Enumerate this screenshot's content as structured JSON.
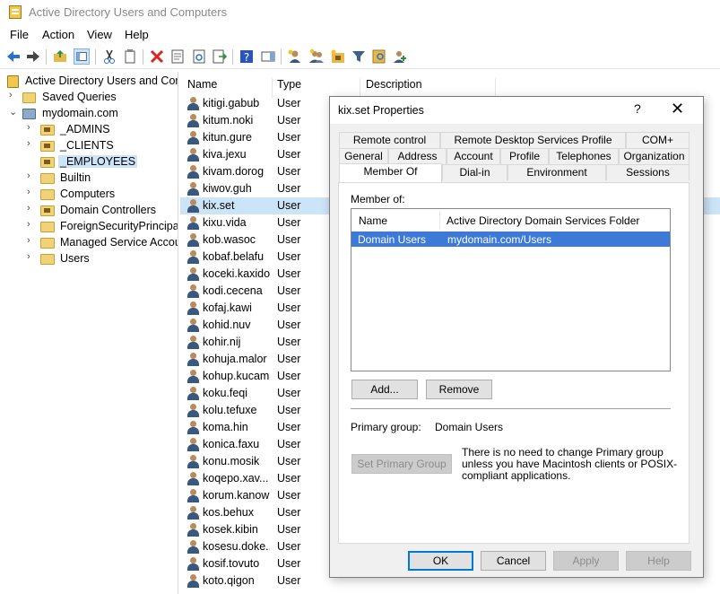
{
  "window": {
    "title": "Active Directory Users and Computers"
  },
  "menu": [
    "File",
    "Action",
    "View",
    "Help"
  ],
  "toolbar": {
    "icons": [
      "back-icon",
      "forward-icon",
      "up-folder-icon",
      "show-hide-console-tree-icon",
      "cut-icon",
      "copy-icon",
      "delete-icon",
      "properties-icon",
      "refresh-icon",
      "export-list-icon",
      "help-icon",
      "show-action-pane-icon",
      "new-user-icon",
      "new-group-icon",
      "new-ou-icon",
      "filter-icon",
      "find-icon",
      "add-to-group-icon"
    ]
  },
  "tree": {
    "root": "Active Directory Users and Com",
    "saved_queries": "Saved Queries",
    "domain": "mydomain.com",
    "children": [
      "_ADMINS",
      "_CLIENTS",
      "_EMPLOYEES",
      "Builtin",
      "Computers",
      "Domain Controllers",
      "ForeignSecurityPrincipals",
      "Managed Service Accoun",
      "Users"
    ],
    "selected": "_EMPLOYEES"
  },
  "list": {
    "columns": {
      "name": "Name",
      "type": "Type",
      "description": "Description"
    },
    "rows": [
      {
        "name": "kitigi.gabub",
        "type": "User"
      },
      {
        "name": "kitum.noki",
        "type": "User"
      },
      {
        "name": "kitun.gure",
        "type": "User"
      },
      {
        "name": "kiva.jexu",
        "type": "User"
      },
      {
        "name": "kivam.dorog",
        "type": "User"
      },
      {
        "name": "kiwov.guh",
        "type": "User"
      },
      {
        "name": "kix.set",
        "type": "User"
      },
      {
        "name": "kixu.vida",
        "type": "User"
      },
      {
        "name": "kob.wasoc",
        "type": "User"
      },
      {
        "name": "kobaf.belafu",
        "type": "User"
      },
      {
        "name": "koceki.kaxido",
        "type": "User"
      },
      {
        "name": "kodi.cecena",
        "type": "User"
      },
      {
        "name": "kofaj.kawi",
        "type": "User"
      },
      {
        "name": "kohid.nuv",
        "type": "User"
      },
      {
        "name": "kohir.nij",
        "type": "User"
      },
      {
        "name": "kohuja.malor",
        "type": "User"
      },
      {
        "name": "kohup.kucam",
        "type": "User"
      },
      {
        "name": "koku.feqi",
        "type": "User"
      },
      {
        "name": "kolu.tefuxe",
        "type": "User"
      },
      {
        "name": "koma.hin",
        "type": "User"
      },
      {
        "name": "konica.faxu",
        "type": "User"
      },
      {
        "name": "konu.mosik",
        "type": "User"
      },
      {
        "name": "koqepo.xav...",
        "type": "User"
      },
      {
        "name": "korum.kanow",
        "type": "User"
      },
      {
        "name": "kos.behux",
        "type": "User"
      },
      {
        "name": "kosek.kibin",
        "type": "User"
      },
      {
        "name": "kosesu.doke...",
        "type": "User"
      },
      {
        "name": "kosif.tovuto",
        "type": "User"
      },
      {
        "name": "koto.qigon",
        "type": "User"
      }
    ],
    "selected": "kix.set"
  },
  "dialog": {
    "title": "kix.set Properties",
    "help": "?",
    "close": "✕",
    "tabs_row1": [
      "Remote control",
      "Remote Desktop Services Profile",
      "COM+"
    ],
    "tabs_row2": [
      "General",
      "Address",
      "Account",
      "Profile",
      "Telephones",
      "Organization"
    ],
    "tabs_row3": [
      "Member Of",
      "Dial-in",
      "Environment",
      "Sessions"
    ],
    "active_tab": "Member Of",
    "member_of_label": "Member of:",
    "member_columns": {
      "name": "Name",
      "folder": "Active Directory Domain Services Folder"
    },
    "members": [
      {
        "name": "Domain Users",
        "folder": "mydomain.com/Users"
      }
    ],
    "add_button": "Add...",
    "remove_button": "Remove",
    "primary_group_label": "Primary group:",
    "primary_group_value": "Domain Users",
    "set_primary_button": "Set Primary Group",
    "note": "There is no need to change Primary group unless you have Macintosh clients or POSIX-compliant applications.",
    "ok": "OK",
    "cancel": "Cancel",
    "apply": "Apply",
    "help_button": "Help"
  }
}
